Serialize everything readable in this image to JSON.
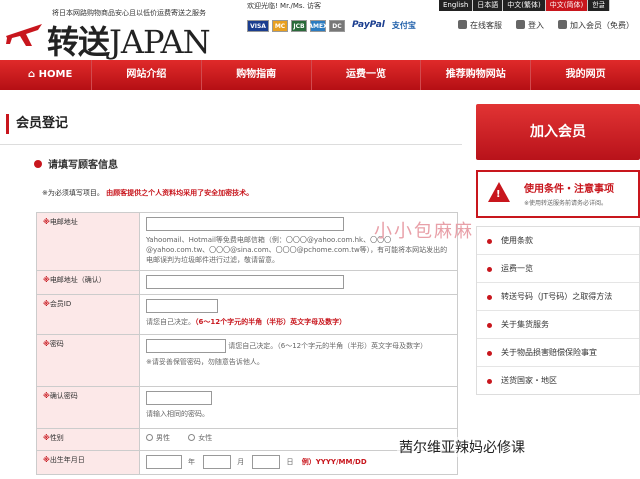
{
  "brand": {
    "tagline": "将日本网路购物商品安心且以低价运费寄送之服务",
    "name_zh": "转送",
    "name_en": "JAPAN"
  },
  "welcome": "欢迎光临! Mr./Ms. 访客",
  "payments": [
    "VISA",
    "MC",
    "JCB",
    "AMEX",
    "DC",
    "PayPal",
    "支付宝"
  ],
  "languages": [
    "English",
    "日本語",
    "中文(繁体)",
    "中文(简体)",
    "한글"
  ],
  "active_language_index": 3,
  "toplinks": {
    "support": "在线客服",
    "login": "登入",
    "register": "加入会员（免费）"
  },
  "nav": [
    "HOME",
    "网站介绍",
    "购物指南",
    "运费一览",
    "推荐购物网站",
    "我的网页"
  ],
  "page_title": "会员登记",
  "section_title": "请填写顾客信息",
  "note": {
    "text": "※为必须填写项目。",
    "red": "由顾客提供之个人资料均采用了安全加密技术。"
  },
  "form": {
    "email": {
      "label": "电邮地址",
      "hint": "Yahoomail、Hotmail等免费电邮信箱（例：〇〇〇@yahoo.com.hk、〇〇〇@yahoo.com.tw、〇〇〇@sina.com、〇〇〇@pchome.com.tw等），有可能将本网站发出的电邮误判为垃圾邮件进行过滤，敬请留意。"
    },
    "email_confirm": {
      "label": "电邮地址（确认）"
    },
    "member_id": {
      "label": "会员ID",
      "hint": "请您自己决定。",
      "hint_red": "（6～12个字元的半角（半形）英文字母及数字）"
    },
    "password": {
      "label": "密码",
      "hint": "请您自己决定。（6～12个字元的半角（半形）英文字母及数字）",
      "hint2": "※请妥善保管密码，勿随意告诉他人。"
    },
    "password_confirm": {
      "label": "确认密码",
      "hint": "请输入相同的密码。"
    },
    "gender": {
      "label": "性别",
      "male": "男性",
      "female": "女性"
    },
    "birthday": {
      "label": "出生年月日",
      "year": "年",
      "month": "月",
      "day": "日",
      "example": "例）YYYY/MM/DD"
    }
  },
  "side": {
    "join_button": "加入会员",
    "notice_title": "使用条件・注意事项",
    "notice_sub": "※使用转送服务前请务必详阅。",
    "menu": [
      "使用条款",
      "运费一览",
      "转送号码（JT号码）之取得方法",
      "关于集货服务",
      "关于物品损害赔偿保险事宜",
      "送货国家・地区"
    ]
  },
  "watermarks": {
    "top": "小小包麻麻",
    "bottom": "茜尔维亚辣妈必修课"
  },
  "colors": {
    "accent": "#c8161d",
    "form_label_bg": "#fce8e8"
  }
}
